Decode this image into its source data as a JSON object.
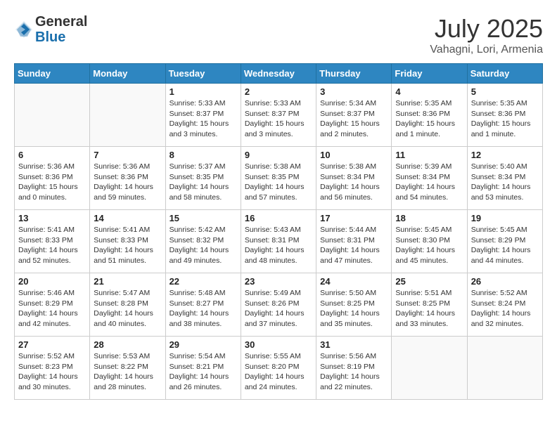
{
  "header": {
    "logo_general": "General",
    "logo_blue": "Blue",
    "month_title": "July 2025",
    "location": "Vahagni, Lori, Armenia"
  },
  "weekdays": [
    "Sunday",
    "Monday",
    "Tuesday",
    "Wednesday",
    "Thursday",
    "Friday",
    "Saturday"
  ],
  "weeks": [
    [
      {
        "day": "",
        "info": ""
      },
      {
        "day": "",
        "info": ""
      },
      {
        "day": "1",
        "info": "Sunrise: 5:33 AM\nSunset: 8:37 PM\nDaylight: 15 hours\nand 3 minutes."
      },
      {
        "day": "2",
        "info": "Sunrise: 5:33 AM\nSunset: 8:37 PM\nDaylight: 15 hours\nand 3 minutes."
      },
      {
        "day": "3",
        "info": "Sunrise: 5:34 AM\nSunset: 8:37 PM\nDaylight: 15 hours\nand 2 minutes."
      },
      {
        "day": "4",
        "info": "Sunrise: 5:35 AM\nSunset: 8:36 PM\nDaylight: 15 hours\nand 1 minute."
      },
      {
        "day": "5",
        "info": "Sunrise: 5:35 AM\nSunset: 8:36 PM\nDaylight: 15 hours\nand 1 minute."
      }
    ],
    [
      {
        "day": "6",
        "info": "Sunrise: 5:36 AM\nSunset: 8:36 PM\nDaylight: 15 hours\nand 0 minutes."
      },
      {
        "day": "7",
        "info": "Sunrise: 5:36 AM\nSunset: 8:36 PM\nDaylight: 14 hours\nand 59 minutes."
      },
      {
        "day": "8",
        "info": "Sunrise: 5:37 AM\nSunset: 8:35 PM\nDaylight: 14 hours\nand 58 minutes."
      },
      {
        "day": "9",
        "info": "Sunrise: 5:38 AM\nSunset: 8:35 PM\nDaylight: 14 hours\nand 57 minutes."
      },
      {
        "day": "10",
        "info": "Sunrise: 5:38 AM\nSunset: 8:34 PM\nDaylight: 14 hours\nand 56 minutes."
      },
      {
        "day": "11",
        "info": "Sunrise: 5:39 AM\nSunset: 8:34 PM\nDaylight: 14 hours\nand 54 minutes."
      },
      {
        "day": "12",
        "info": "Sunrise: 5:40 AM\nSunset: 8:34 PM\nDaylight: 14 hours\nand 53 minutes."
      }
    ],
    [
      {
        "day": "13",
        "info": "Sunrise: 5:41 AM\nSunset: 8:33 PM\nDaylight: 14 hours\nand 52 minutes."
      },
      {
        "day": "14",
        "info": "Sunrise: 5:41 AM\nSunset: 8:33 PM\nDaylight: 14 hours\nand 51 minutes."
      },
      {
        "day": "15",
        "info": "Sunrise: 5:42 AM\nSunset: 8:32 PM\nDaylight: 14 hours\nand 49 minutes."
      },
      {
        "day": "16",
        "info": "Sunrise: 5:43 AM\nSunset: 8:31 PM\nDaylight: 14 hours\nand 48 minutes."
      },
      {
        "day": "17",
        "info": "Sunrise: 5:44 AM\nSunset: 8:31 PM\nDaylight: 14 hours\nand 47 minutes."
      },
      {
        "day": "18",
        "info": "Sunrise: 5:45 AM\nSunset: 8:30 PM\nDaylight: 14 hours\nand 45 minutes."
      },
      {
        "day": "19",
        "info": "Sunrise: 5:45 AM\nSunset: 8:29 PM\nDaylight: 14 hours\nand 44 minutes."
      }
    ],
    [
      {
        "day": "20",
        "info": "Sunrise: 5:46 AM\nSunset: 8:29 PM\nDaylight: 14 hours\nand 42 minutes."
      },
      {
        "day": "21",
        "info": "Sunrise: 5:47 AM\nSunset: 8:28 PM\nDaylight: 14 hours\nand 40 minutes."
      },
      {
        "day": "22",
        "info": "Sunrise: 5:48 AM\nSunset: 8:27 PM\nDaylight: 14 hours\nand 38 minutes."
      },
      {
        "day": "23",
        "info": "Sunrise: 5:49 AM\nSunset: 8:26 PM\nDaylight: 14 hours\nand 37 minutes."
      },
      {
        "day": "24",
        "info": "Sunrise: 5:50 AM\nSunset: 8:25 PM\nDaylight: 14 hours\nand 35 minutes."
      },
      {
        "day": "25",
        "info": "Sunrise: 5:51 AM\nSunset: 8:25 PM\nDaylight: 14 hours\nand 33 minutes."
      },
      {
        "day": "26",
        "info": "Sunrise: 5:52 AM\nSunset: 8:24 PM\nDaylight: 14 hours\nand 32 minutes."
      }
    ],
    [
      {
        "day": "27",
        "info": "Sunrise: 5:52 AM\nSunset: 8:23 PM\nDaylight: 14 hours\nand 30 minutes."
      },
      {
        "day": "28",
        "info": "Sunrise: 5:53 AM\nSunset: 8:22 PM\nDaylight: 14 hours\nand 28 minutes."
      },
      {
        "day": "29",
        "info": "Sunrise: 5:54 AM\nSunset: 8:21 PM\nDaylight: 14 hours\nand 26 minutes."
      },
      {
        "day": "30",
        "info": "Sunrise: 5:55 AM\nSunset: 8:20 PM\nDaylight: 14 hours\nand 24 minutes."
      },
      {
        "day": "31",
        "info": "Sunrise: 5:56 AM\nSunset: 8:19 PM\nDaylight: 14 hours\nand 22 minutes."
      },
      {
        "day": "",
        "info": ""
      },
      {
        "day": "",
        "info": ""
      }
    ]
  ]
}
